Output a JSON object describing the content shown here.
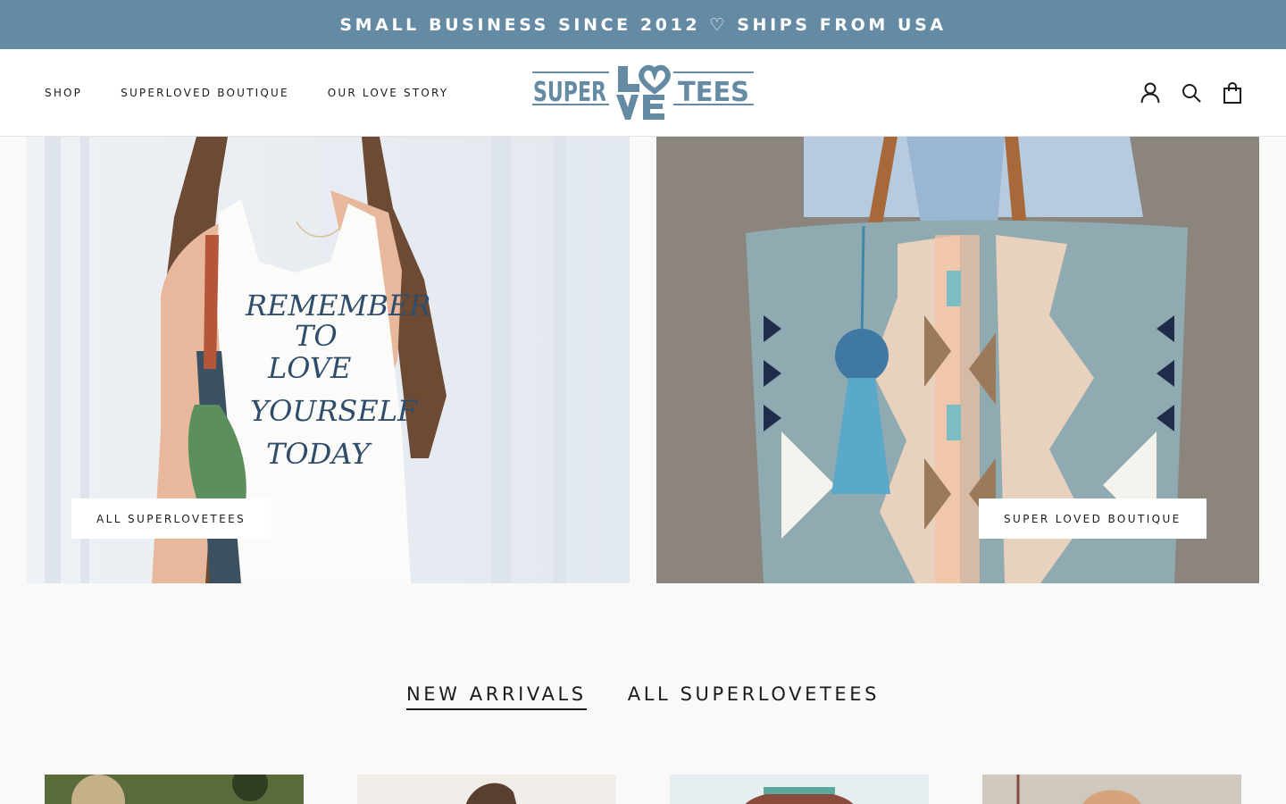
{
  "announcement": {
    "text": "SMALL BUSINESS SINCE 2012 ♡ SHIPS FROM USA"
  },
  "nav": {
    "items": [
      {
        "label": "SHOP"
      },
      {
        "label": "SUPERLOVED BOUTIQUE"
      },
      {
        "label": "OUR LOVE STORY"
      }
    ]
  },
  "logo": {
    "word_left": "SUPER",
    "word_right": "TEES",
    "letters_top": "LO",
    "letters_bottom": "VE"
  },
  "icons": {
    "account": "account-icon",
    "search": "search-icon",
    "cart": "cart-icon"
  },
  "promos": [
    {
      "button_label": "ALL SUPERLOVETEES",
      "shirt_text": [
        "REMEMBER",
        "TO",
        "LOVE",
        "YOURSELF",
        "TODAY"
      ]
    },
    {
      "button_label": "SUPER LOVED BOUTIQUE"
    }
  ],
  "collection_tabs": [
    {
      "label": "NEW ARRIVALS",
      "active": true
    },
    {
      "label": "ALL SUPERLOVETEES",
      "active": false
    }
  ],
  "colors": {
    "accent": "#658ba4",
    "text": "#1c1b1b",
    "background": "#f9f9f9"
  }
}
